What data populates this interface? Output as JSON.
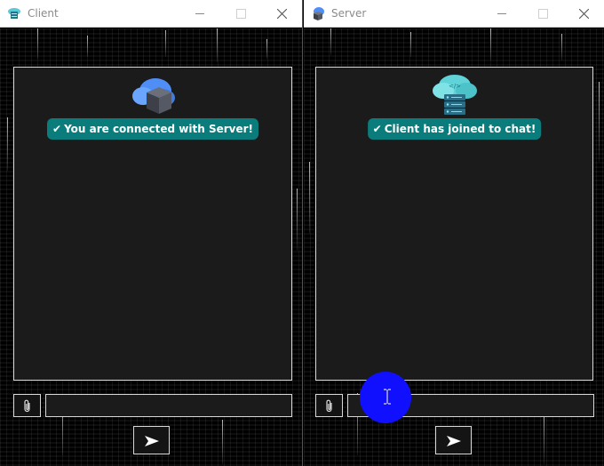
{
  "client_window": {
    "title": "Client",
    "status_message": "You are connected with Server!",
    "message_input": {
      "value": "",
      "placeholder": ""
    },
    "icons": {
      "app": "cloud-server-icon",
      "avatar": "cloud-server-avatar-icon",
      "check": "checkmark-icon",
      "attach": "paperclip-icon",
      "send": "send-arrow-icon"
    }
  },
  "server_window": {
    "title": "Server",
    "status_message": "Client has joined to chat!",
    "message_input": {
      "value": "",
      "placeholder": ""
    },
    "icons": {
      "app": "cloud-server-icon",
      "avatar": "cloud-database-avatar-icon",
      "check": "checkmark-icon",
      "attach": "paperclip-icon",
      "send": "send-arrow-icon"
    }
  },
  "glyphs": {
    "check": "✔"
  },
  "colors": {
    "bubble": "#0b7c7c",
    "panel": "#1b1b1b",
    "border": "#d8d8d8",
    "cursor_highlight": "#1010ff",
    "titlebar": "#ffffff"
  }
}
